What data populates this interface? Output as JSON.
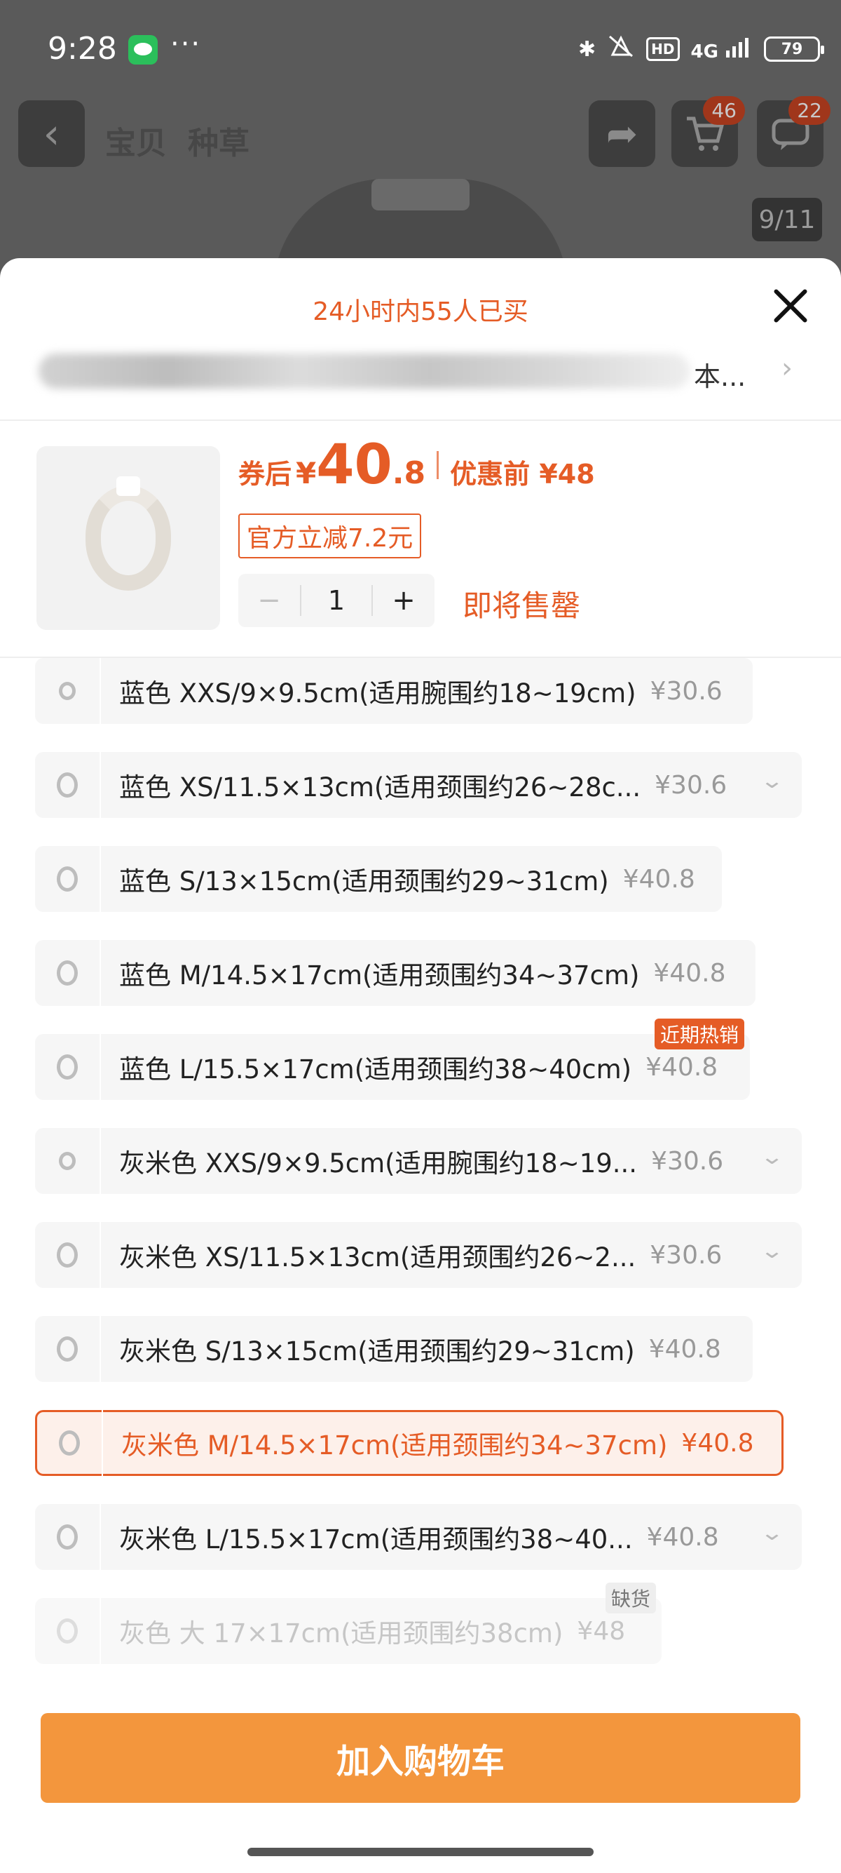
{
  "status_bar": {
    "time": "9:28",
    "dots": "···",
    "bluetooth": "✱",
    "hd": "HD",
    "network": "4G",
    "battery": "79"
  },
  "header": {
    "back": "‹",
    "tabs": [
      "宝贝",
      "种草"
    ],
    "share_icon": "➦",
    "cart_badge": "46",
    "msg_badge": "22",
    "page_indicator": "9/11"
  },
  "sheet": {
    "bought": "24小时内55人已买",
    "address_suffix": "本...",
    "address_arrow": "›",
    "price": {
      "label": "券后",
      "symbol": "¥",
      "integer": "40",
      "decimal": ".8",
      "original": "优惠前 ¥48"
    },
    "coupon": "官方立减7.2元",
    "stepper": {
      "minus": "−",
      "value": "1",
      "plus": "+"
    },
    "stock_note": "即将售罄",
    "variants": [
      {
        "text": "蓝色 XXS/9×9.5cm(适用腕围约18~19cm)",
        "price": "¥30.6"
      },
      {
        "text": "蓝色 XS/11.5×13cm(适用颈围约26~28c...",
        "price": "¥30.6",
        "chevron": "⌄"
      },
      {
        "text": "蓝色 S/13×15cm(适用颈围约29~31cm)",
        "price": "¥40.8"
      },
      {
        "text": "蓝色 M/14.5×17cm(适用颈围约34~37cm)",
        "price": "¥40.8"
      },
      {
        "text": "蓝色 L/15.5×17cm(适用颈围约38~40cm)",
        "price": "¥40.8",
        "tag": "近期热销"
      },
      {
        "text": "灰米色 XXS/9×9.5cm(适用腕围约18~19...",
        "price": "¥30.6",
        "chevron": "⌄"
      },
      {
        "text": "灰米色 XS/11.5×13cm(适用颈围约26~2...",
        "price": "¥30.6",
        "chevron": "⌄"
      },
      {
        "text": "灰米色 S/13×15cm(适用颈围约29~31cm)",
        "price": "¥40.8"
      },
      {
        "text": "灰米色 M/14.5×17cm(适用颈围约34~37cm)",
        "price": "¥40.8"
      },
      {
        "text": "灰米色 L/15.5×17cm(适用颈围约38~40...",
        "price": "¥40.8",
        "chevron": "⌄"
      },
      {
        "text": "灰色 大 17×17cm(适用颈围约38cm)",
        "price": "¥48",
        "tag": "缺货"
      }
    ],
    "add_to_cart": "加入购物车"
  },
  "colors": {
    "accent": "#e55c26",
    "button": "#f3963d"
  }
}
